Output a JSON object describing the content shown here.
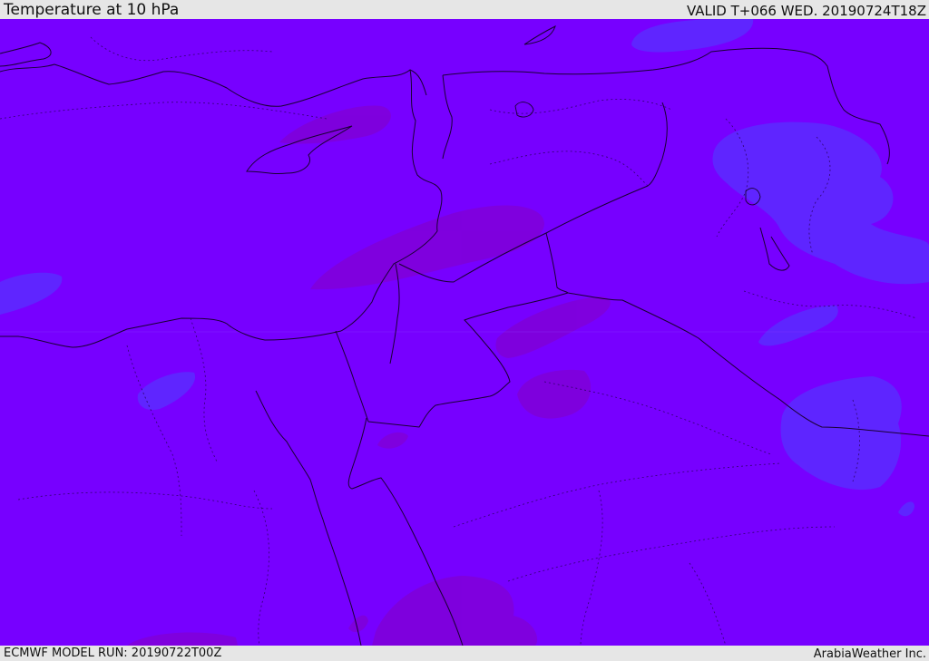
{
  "header": {
    "title": "Temperature at 10 hPa",
    "valid_time": "VALID T+066 WED. 20190724T18Z"
  },
  "footer": {
    "model_run": "ECMWF MODEL RUN: 20190722T00Z",
    "credit": "ArabiaWeather Inc."
  },
  "colors": {
    "base_field": "#7700ff",
    "warm_patch": "#8000d8",
    "cool_patch": "#5a2cff",
    "coastline": "#1a0033",
    "border": "#1a0033"
  }
}
